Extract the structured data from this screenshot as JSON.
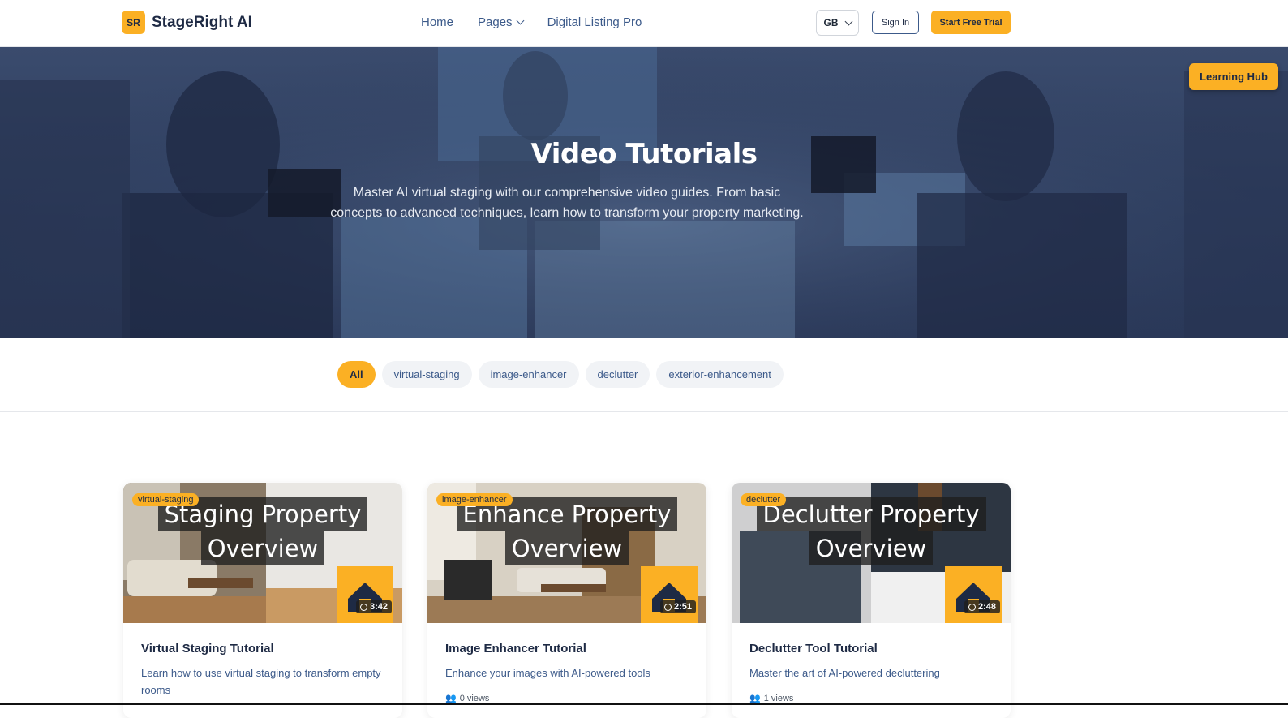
{
  "header": {
    "logo_badge": "SR",
    "logo_text": "StageRight AI",
    "nav": [
      "Home",
      "Pages",
      "Digital Listing Pro"
    ],
    "language": "GB",
    "sign_in": "Sign In",
    "start_trial": "Start Free Trial"
  },
  "hero": {
    "title": "Video Tutorials",
    "subtitle": "Master AI virtual staging with our comprehensive video guides. From basic concepts to advanced techniques, learn how to transform your property marketing.",
    "learning_hub": "Learning Hub"
  },
  "filters": [
    "All",
    "virtual-staging",
    "image-enhancer",
    "declutter",
    "exterior-enhancement"
  ],
  "cards": [
    {
      "tag": "virtual-staging",
      "overlay_line1": "Staging Property",
      "overlay_line2": "Overview",
      "duration": "3:42",
      "title": "Virtual Staging Tutorial",
      "desc": "Learn how to use virtual staging to transform empty rooms",
      "views": ""
    },
    {
      "tag": "image-enhancer",
      "overlay_line1": "Enhance Property",
      "overlay_line2": "Overview",
      "duration": "2:51",
      "title": "Image Enhancer Tutorial",
      "desc": "Enhance your images with AI-powered tools",
      "views": "0 views"
    },
    {
      "tag": "declutter",
      "overlay_line1": "Declutter Property",
      "overlay_line2": "Overview",
      "duration": "2:48",
      "title": "Declutter Tool Tutorial",
      "desc": "Master the art of AI-powered decluttering",
      "views": "1 views"
    }
  ],
  "colors": {
    "accent": "#fbb024",
    "navy": "#1e2a44",
    "link": "#3c5a8a"
  }
}
